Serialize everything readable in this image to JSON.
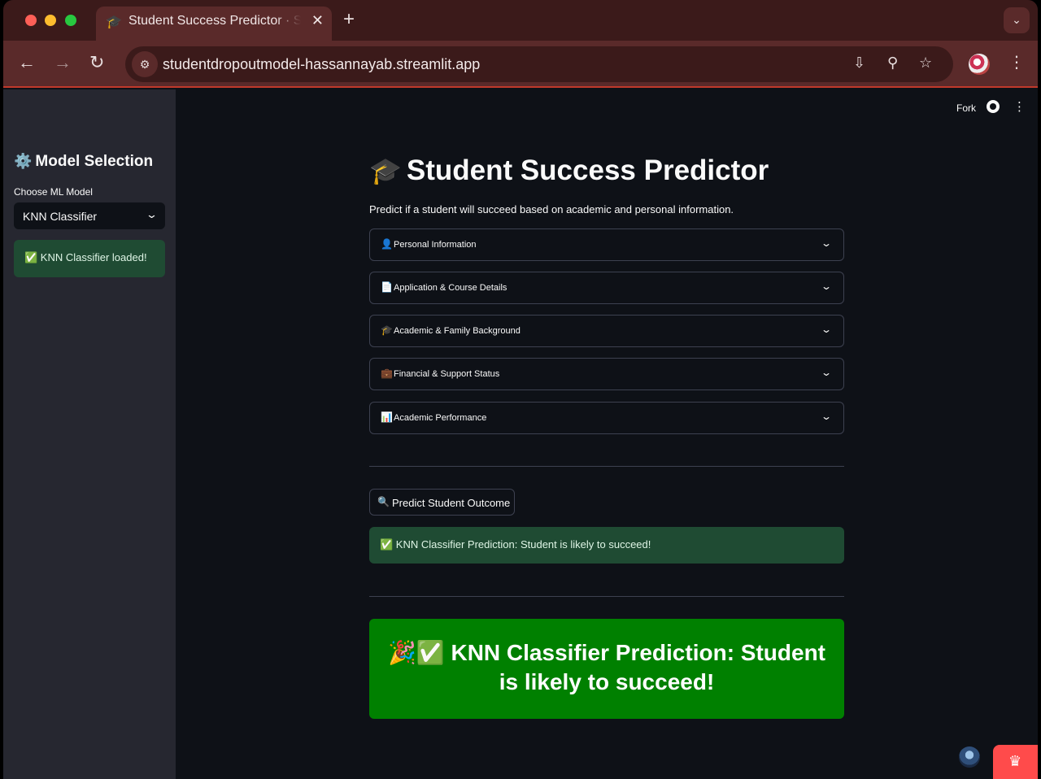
{
  "browser": {
    "tab": {
      "favicon": "🎓",
      "title": "Student Success Predictor · S",
      "close": "✕"
    },
    "new_tab": "+",
    "tab_search": "⌄",
    "nav": {
      "back": "←",
      "forward": "→",
      "reload": "↻"
    },
    "site_info": "⚙",
    "url": "studentdropoutmodel-hassannayab.streamlit.app",
    "omnibox_icons": {
      "install": "⇩",
      "zoom": "⚲",
      "bookmark": "☆"
    },
    "menu": "⋮",
    "colors": {
      "frame": "#3b1a1a",
      "toolbar": "#5a2a2a"
    }
  },
  "header": {
    "fork": "Fork",
    "menu": "⋮"
  },
  "sidebar": {
    "title_icon": "⚙️",
    "title": "Model Selection",
    "select_label": "Choose ML Model",
    "select_value": "KNN Classifier",
    "select_chevron": "⌄",
    "alert": "✅ KNN Classifier loaded!"
  },
  "main": {
    "title_icon": "🎓",
    "title": "Student Success Predictor",
    "subtitle": "Predict if a student will succeed based on academic and personal information.",
    "expanders": [
      {
        "icon": "👤",
        "label": "Personal Information"
      },
      {
        "icon": "📄",
        "label": "Application & Course Details"
      },
      {
        "icon": "🎓",
        "label": "Academic & Family Background"
      },
      {
        "icon": "💼",
        "label": "Financial & Support Status"
      },
      {
        "icon": "📊",
        "label": "Academic Performance"
      }
    ],
    "expander_chevron": "⌄",
    "predict_button": {
      "icon": "🔍",
      "label": "Predict Student Outcome"
    },
    "result_alert": "✅ KNN Classifier Prediction: Student is likely to succeed!",
    "banner": "🎉✅ KNN Classifier Prediction: Student is likely to succeed!",
    "colors": {
      "success_alert": "#1f4b33",
      "banner": "#008000",
      "accent": "#ff4b4b"
    }
  },
  "footer": {
    "crown": "♛"
  }
}
